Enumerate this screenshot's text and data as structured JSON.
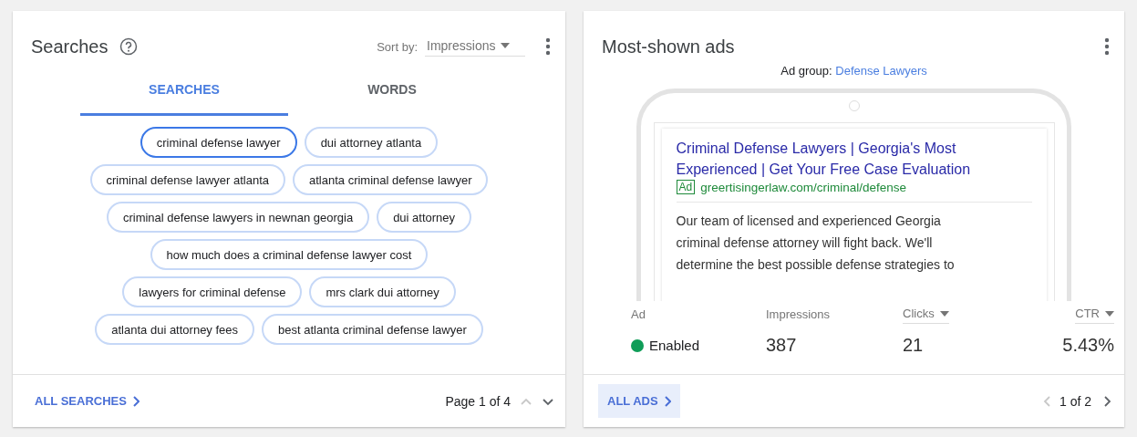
{
  "searches_card": {
    "title": "Searches",
    "sort_label": "Sort by:",
    "sort_value": "Impressions",
    "tabs": [
      {
        "label": "SEARCHES",
        "selected": true
      },
      {
        "label": "WORDS",
        "selected": false
      }
    ],
    "chip_rows": [
      [
        {
          "label": "criminal defense lawyer",
          "selected": true
        },
        {
          "label": "dui attorney atlanta",
          "selected": false
        }
      ],
      [
        {
          "label": "criminal defense lawyer atlanta",
          "selected": false
        },
        {
          "label": "atlanta criminal defense lawyer",
          "selected": false
        }
      ],
      [
        {
          "label": "criminal defense lawyers in newnan georgia",
          "selected": false
        },
        {
          "label": "dui attorney",
          "selected": false
        }
      ],
      [
        {
          "label": "how much does a criminal defense lawyer cost",
          "selected": false
        }
      ],
      [
        {
          "label": "lawyers for criminal defense",
          "selected": false
        },
        {
          "label": "mrs clark dui attorney",
          "selected": false
        }
      ],
      [
        {
          "label": "atlanta dui attorney fees",
          "selected": false
        },
        {
          "label": "best atlanta criminal defense lawyer",
          "selected": false
        }
      ]
    ],
    "footer_link": "ALL SEARCHES",
    "page": "Page 1 of 4",
    "prev_disabled": true,
    "next_disabled": false
  },
  "ads_card": {
    "title": "Most-shown ads",
    "ad_group_label": "Ad group:",
    "ad_group": "Defense Lawyers",
    "ad": {
      "headline_lines": [
        "Criminal Defense Lawyers | Georgia's Most",
        "Experienced | Get Your Free Case Evaluation"
      ],
      "badge": "Ad",
      "url": "greertisingerlaw.com/criminal/defense",
      "description_lines": [
        "Our team of licensed and experienced Georgia",
        "criminal defense attorney will fight back. We'll",
        "determine the best possible defense strategies to"
      ]
    },
    "columns": [
      {
        "label": "Ad",
        "sortable": false
      },
      {
        "label": "Impressions",
        "sortable": false
      },
      {
        "label": "Clicks",
        "sortable": true
      },
      {
        "label": "CTR",
        "sortable": true
      }
    ],
    "status": {
      "label": "Enabled",
      "color": "#0f9d58"
    },
    "values": [
      "387",
      "21",
      "5.43%"
    ],
    "footer_link": "ALL ADS",
    "pager": "1 of 2",
    "prev_disabled": true,
    "next_disabled": false
  }
}
